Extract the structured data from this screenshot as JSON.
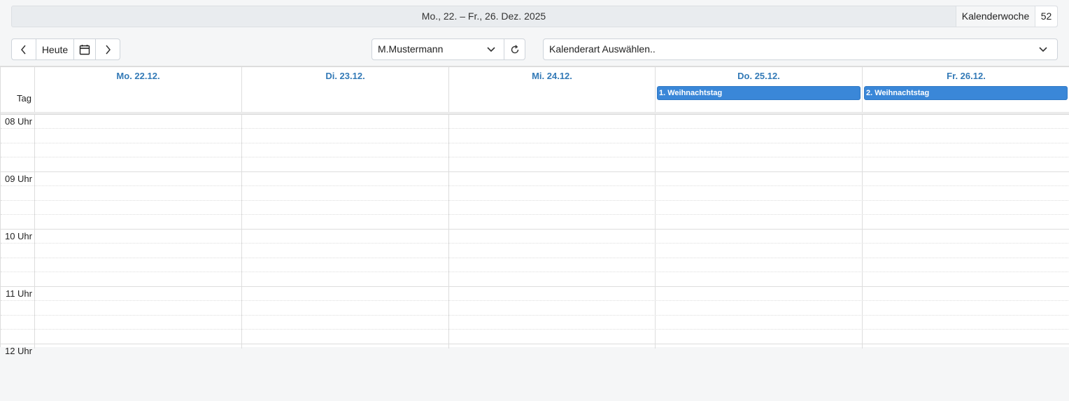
{
  "header": {
    "date_range": "Mo., 22. – Fr., 26. Dez. 2025",
    "week_label": "Kalenderwoche",
    "week_number": "52"
  },
  "toolbar": {
    "prev_icon": "chevron-left-icon",
    "today_label": "Heute",
    "calendar_icon": "calendar-icon",
    "next_icon": "chevron-right-icon",
    "user_value": "M.Mustermann",
    "refresh_icon": "refresh-icon",
    "calendar_type_placeholder": "Kalenderart Auswählen.."
  },
  "calendar": {
    "allday_label": "Tag",
    "days": [
      {
        "label": "Mo. 22.12.",
        "event": ""
      },
      {
        "label": "Di. 23.12.",
        "event": ""
      },
      {
        "label": "Mi. 24.12.",
        "event": ""
      },
      {
        "label": "Do. 25.12.",
        "event": "1. Weihnachtstag"
      },
      {
        "label": "Fr. 26.12.",
        "event": "2. Weihnachtstag"
      }
    ],
    "hours": [
      "08 Uhr",
      "09 Uhr",
      "10 Uhr",
      "11 Uhr",
      "12 Uhr"
    ]
  },
  "colors": {
    "accent": "#337ab7",
    "event_bg": "#3a87d8"
  }
}
